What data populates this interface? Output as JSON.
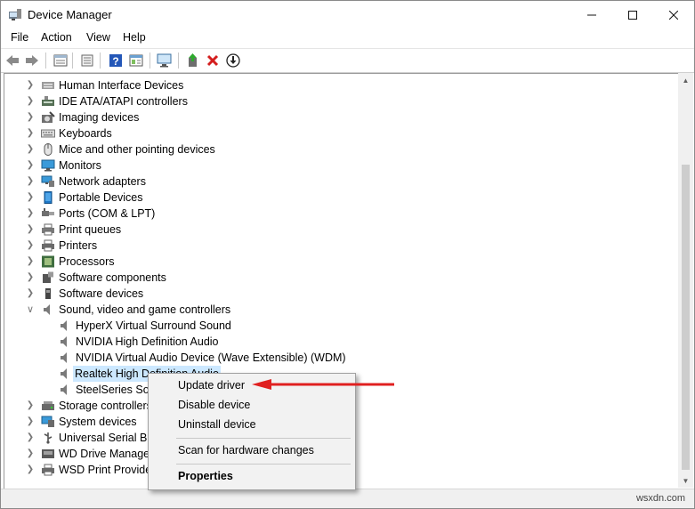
{
  "window": {
    "title": "Device Manager",
    "controls": {
      "minimize": "—",
      "maximize": "☐",
      "close": "✕"
    }
  },
  "menubar": {
    "items": [
      "File",
      "Action",
      "View",
      "Help"
    ]
  },
  "toolbar": {
    "buttons": [
      "back-arrow-icon",
      "forward-arrow-icon",
      "properties-sheet-icon",
      "list-view-icon",
      "help-icon",
      "device-view-icon",
      "monitor-scan-icon",
      "update-driver-icon",
      "uninstall-x-icon",
      "download-circle-icon"
    ]
  },
  "tree": {
    "categories_top": [
      {
        "label": "Human Interface Devices",
        "icon": "hid-icon"
      },
      {
        "label": "IDE ATA/ATAPI controllers",
        "icon": "ide-icon"
      },
      {
        "label": "Imaging devices",
        "icon": "camera-icon"
      },
      {
        "label": "Keyboards",
        "icon": "keyboard-icon"
      },
      {
        "label": "Mice and other pointing devices",
        "icon": "mouse-icon"
      },
      {
        "label": "Monitors",
        "icon": "monitor-icon"
      },
      {
        "label": "Network adapters",
        "icon": "network-icon"
      },
      {
        "label": "Portable Devices",
        "icon": "portable-icon"
      },
      {
        "label": "Ports (COM & LPT)",
        "icon": "port-icon"
      },
      {
        "label": "Print queues",
        "icon": "print-queue-icon"
      },
      {
        "label": "Printers",
        "icon": "printer-icon"
      },
      {
        "label": "Processors",
        "icon": "processor-icon"
      },
      {
        "label": "Software components",
        "icon": "software-component-icon"
      },
      {
        "label": "Software devices",
        "icon": "software-device-icon"
      }
    ],
    "expanded_category": {
      "label": "Sound, video and game controllers",
      "icon": "speaker-icon"
    },
    "children": [
      {
        "label": "HyperX Virtual Surround Sound"
      },
      {
        "label": "NVIDIA High Definition Audio"
      },
      {
        "label": "NVIDIA Virtual Audio Device (Wave Extensible) (WDM)"
      },
      {
        "label": "Realtek High Definition Audio",
        "selected": true
      },
      {
        "label": "SteelSeries Sonar Virtual Audio Device"
      }
    ],
    "categories_bottom": [
      {
        "label": "Storage controllers",
        "icon": "storage-icon"
      },
      {
        "label": "System devices",
        "icon": "system-icon"
      },
      {
        "label": "Universal Serial Bus controllers",
        "icon": "usb-icon"
      },
      {
        "label": "WD Drive Management devices",
        "icon": "wd-icon"
      },
      {
        "label": "WSD Print Provider",
        "icon": "wsd-icon"
      }
    ]
  },
  "context_menu": {
    "update_driver": "Update driver",
    "disable_device": "Disable device",
    "uninstall_device": "Uninstall device",
    "scan": "Scan for hardware changes",
    "properties": "Properties"
  },
  "watermark": "wsxdn.com",
  "colors": {
    "selection": "#cce8ff",
    "arrow": "#e02020",
    "menu_bg": "#f2f2f2"
  }
}
